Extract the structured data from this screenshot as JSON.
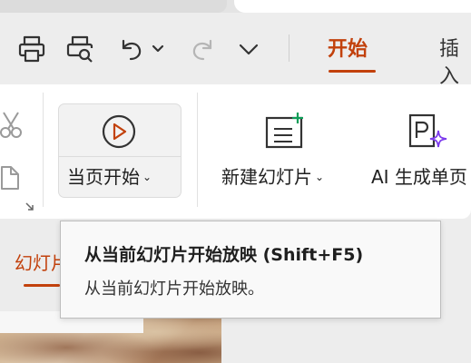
{
  "quick_access": {
    "icons": [
      "print-icon",
      "print-preview-icon",
      "undo-icon",
      "undo-dropdown-icon",
      "redo-icon",
      "customize-dropdown-icon"
    ]
  },
  "tabs": {
    "active_label": "开始",
    "next_label": "插入"
  },
  "ribbon": {
    "play_from_current_label": "当页开始",
    "new_slide_label": "新建幻灯片",
    "ai_label": "AI 生成单页",
    "dropdown_glyph": "⌄"
  },
  "left_panel": {
    "tab_label": "幻灯片"
  },
  "tooltip": {
    "title": "从当前幻灯片开始放映 (Shift+F5)",
    "description": "从当前幻灯片开始放映。"
  },
  "colors": {
    "accent": "#c2410c",
    "ai_sparkle": "#7c3aed",
    "new_slide_plus": "#0f9d58"
  }
}
